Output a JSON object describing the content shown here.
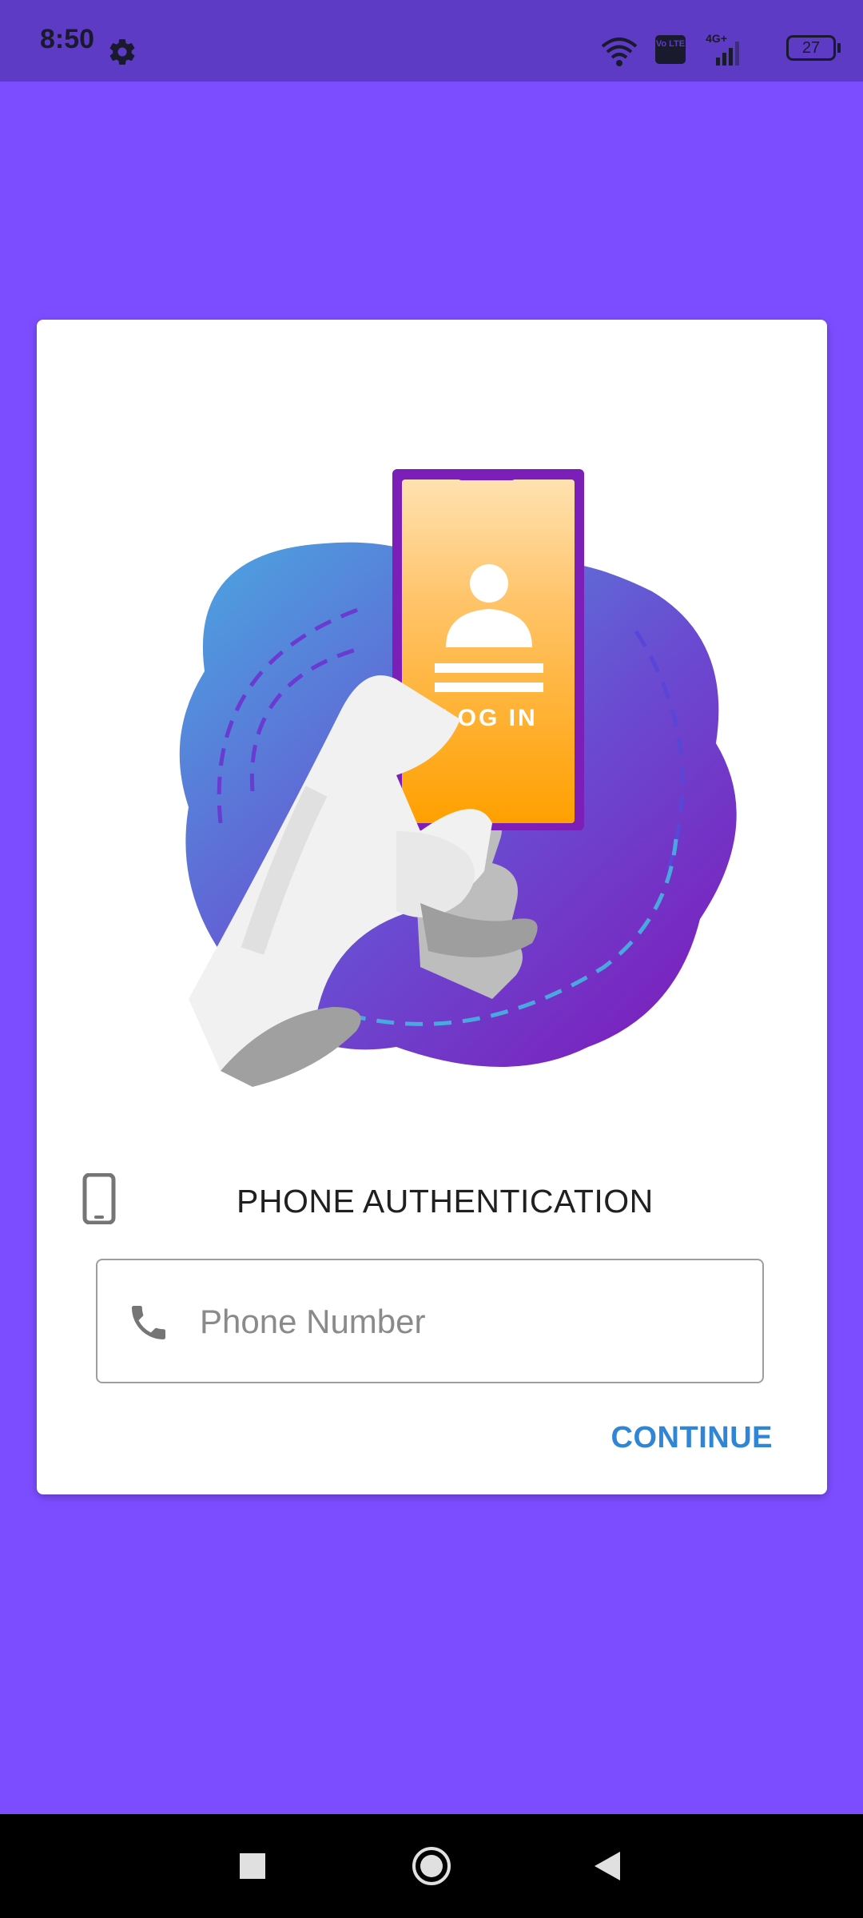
{
  "status_bar": {
    "time": "8:50",
    "battery": "27",
    "network": "4G+",
    "volte": "Vo LTE"
  },
  "card": {
    "illustration_text": "LOG IN",
    "auth_title": "PHONE AUTHENTICATION",
    "phone_field": {
      "placeholder": "Phone Number",
      "value": ""
    },
    "continue_label": "CONTINUE"
  },
  "colors": {
    "background": "#7c4dff",
    "status_bar": "#5e3bc4",
    "accent": "#2f86d6",
    "card": "#ffffff"
  },
  "icons": {
    "status": [
      "gear-icon",
      "wifi-icon",
      "volte-icon",
      "signal-icon",
      "battery-icon"
    ],
    "card": [
      "smartphone-icon",
      "phone-icon"
    ],
    "nav": [
      "square-icon",
      "circle-icon",
      "back-triangle-icon"
    ]
  }
}
